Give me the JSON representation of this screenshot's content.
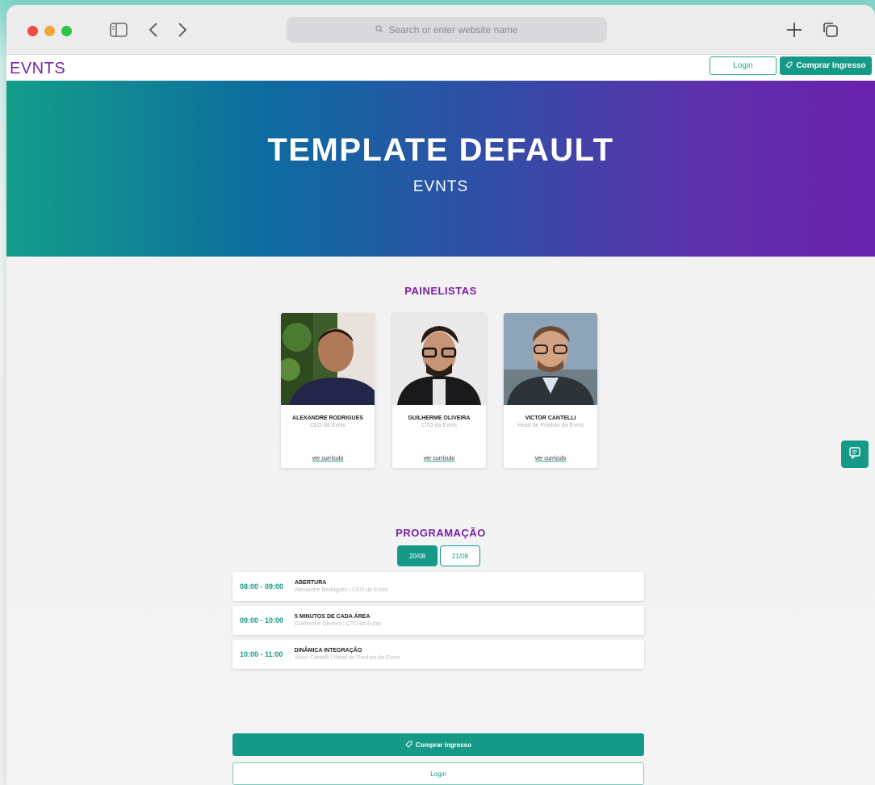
{
  "browser": {
    "url_placeholder": "Search or enter website name"
  },
  "header": {
    "logo": "EVNTS",
    "login_label": "Login",
    "buy_label": "Comprar Ingresso"
  },
  "hero": {
    "title": "TEMPLATE DEFAULT",
    "logo": "EVNTS"
  },
  "panelists": {
    "title": "PAINELISTAS",
    "items": [
      {
        "name": "ALEXANDRE RODRIGUES",
        "role": "CEO da Evnts",
        "link": "ver currículo"
      },
      {
        "name": "GUILHERME OLIVEIRA",
        "role": "CTO da Evnts",
        "link": "ver currículo"
      },
      {
        "name": "VICTOR CANTELLI",
        "role": "Head de Produto da Evnts",
        "link": "ver currículo"
      }
    ]
  },
  "schedule": {
    "title": "PROGRAMAÇÃO",
    "dates": [
      "20/08",
      "21/08"
    ],
    "selected_date": "20/08",
    "items": [
      {
        "time": "08:00 - 09:00",
        "name": "ABERTURA",
        "speaker": "Alexandre Rodrigues | CEO da Evnts"
      },
      {
        "time": "09:00 - 10:00",
        "name": "5 MINUTOS DE CADA ÁREA",
        "speaker": "Guilherme Oliveira | CTO da Evnts"
      },
      {
        "time": "10:00 - 11:00",
        "name": "DINÂMICA INTEGRAÇÃO",
        "speaker": "Victor Cantelli | Head de Produto da Evnts"
      }
    ]
  },
  "footer_actions": {
    "buy_label": "Comprar ingresso",
    "login_label": "Login"
  },
  "colors": {
    "accent": "#169a88",
    "brand_purple": "#7a1fa6"
  },
  "icons": {
    "chat": "chat-icon",
    "tag": "tag-icon",
    "search": "search-icon"
  }
}
